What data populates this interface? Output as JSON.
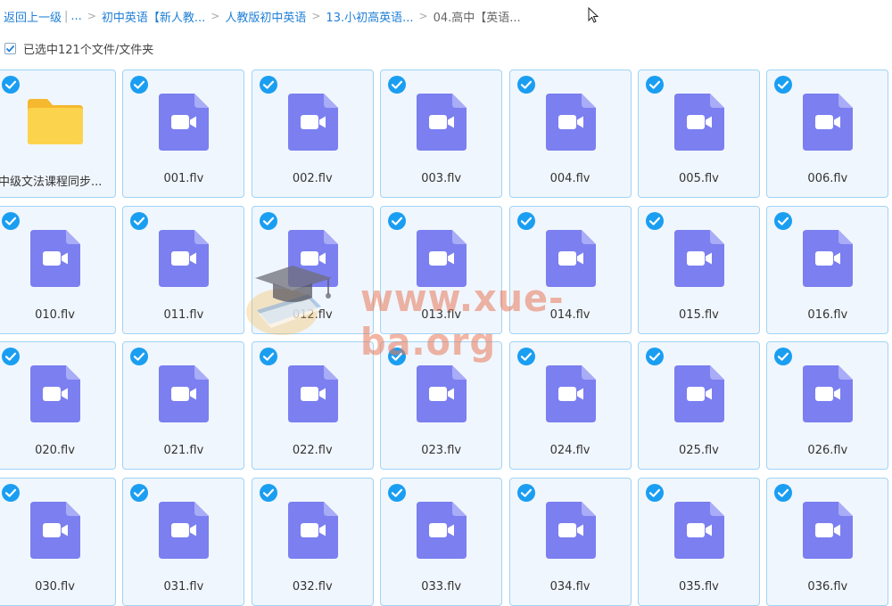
{
  "breadcrumb": {
    "back": "返回上一级",
    "ellipsis": "...",
    "items": [
      "初中英语【新人教...",
      "人教版初中英语",
      "13.小初高英语...",
      "04.高中【英语..."
    ]
  },
  "selection": {
    "text": "已选中121个文件/文件夹",
    "checked": true
  },
  "folder": {
    "name": "中级文法课程同步...",
    "icon": "folder-icon"
  },
  "files": [
    "001.flv",
    "002.flv",
    "003.flv",
    "004.flv",
    "005.flv",
    "006.flv",
    "010.flv",
    "011.flv",
    "012.flv",
    "013.flv",
    "014.flv",
    "015.flv",
    "016.flv",
    "020.flv",
    "021.flv",
    "022.flv",
    "023.flv",
    "024.flv",
    "025.flv",
    "026.flv",
    "030.flv",
    "031.flv",
    "032.flv",
    "033.flv",
    "034.flv",
    "035.flv",
    "036.flv"
  ],
  "watermark": {
    "text": "www.xue-ba.org"
  },
  "colors": {
    "accent": "#1f7fd6",
    "tile_border": "#9fd4f6",
    "tile_bg": "#f0f6fd",
    "check": "#1a9ef2",
    "video_icon": "#7b7ff0",
    "folder": "#fcd34d"
  }
}
